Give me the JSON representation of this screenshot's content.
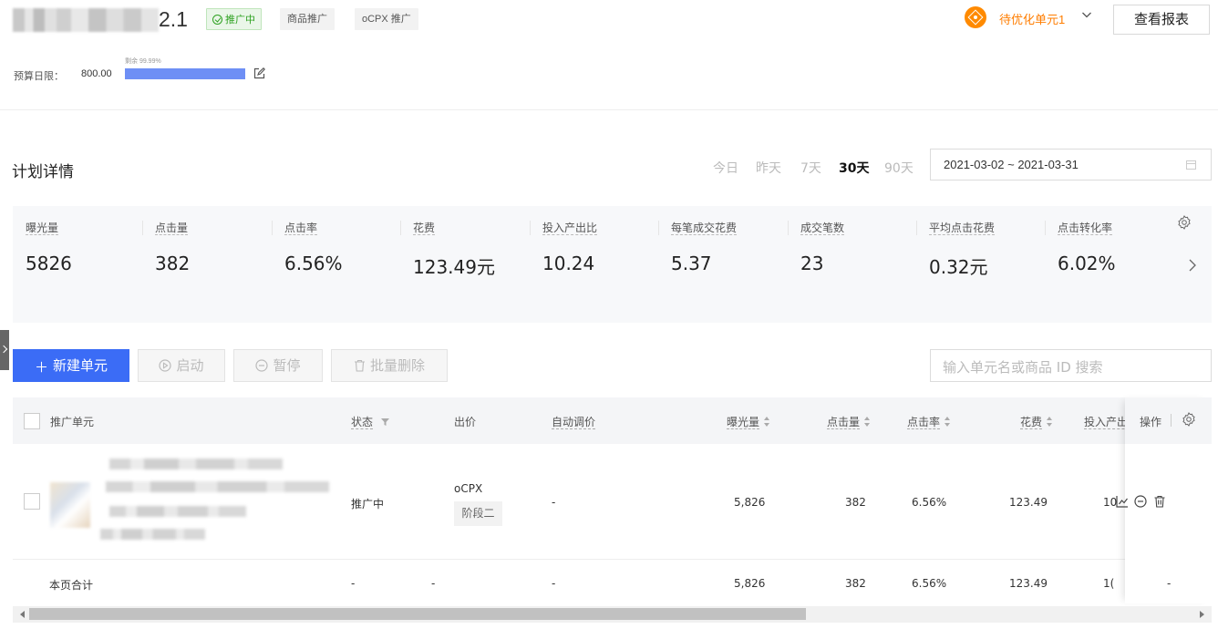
{
  "header": {
    "title_visible": "2.1",
    "status_tag": "推广中",
    "type_tags": [
      "商品推广",
      "oCPX 推广"
    ],
    "budget_label": "预算日限：",
    "budget_value": "800.00",
    "budget_remaining": "剩余 99.99%",
    "budget_remaining_fraction": 0.9999,
    "alert_text": "待优化单元1",
    "report_button": "查看报表"
  },
  "details": {
    "title": "计划详情",
    "ranges": [
      "今日",
      "昨天",
      "7天",
      "30天",
      "90天"
    ],
    "active_range": "30天",
    "date_range": "2021-03-02 ~ 2021-03-31"
  },
  "metrics": [
    {
      "label": "曝光量",
      "value": "5826"
    },
    {
      "label": "点击量",
      "value": "382"
    },
    {
      "label": "点击率",
      "value": "6.56%"
    },
    {
      "label": "花费",
      "value": "123.49元"
    },
    {
      "label": "投入产出比",
      "value": "10.24"
    },
    {
      "label": "每笔成交花费",
      "value": "5.37"
    },
    {
      "label": "成交笔数",
      "value": "23"
    },
    {
      "label": "平均点击花费",
      "value": "0.32元"
    },
    {
      "label": "点击转化率",
      "value": "6.02%"
    }
  ],
  "toolbar": {
    "new_unit": "新建单元",
    "start": "启动",
    "pause": "暂停",
    "batch_delete": "批量删除",
    "search_placeholder": "输入单元名或商品 ID 搜索"
  },
  "table": {
    "columns": {
      "unit": "推广单元",
      "status": "状态",
      "bid": "出价",
      "auto_bid": "自动调价",
      "impressions": "曝光量",
      "clicks": "点击量",
      "ctr": "点击率",
      "cost": "花费",
      "roi": "投入产出比",
      "actions": "操作"
    },
    "rows": [
      {
        "status": "推广中",
        "bid_type": "oCPX",
        "bid_stage": "阶段二",
        "auto_bid": "-",
        "impressions": "5,826",
        "clicks": "382",
        "ctr": "6.56%",
        "cost": "123.49",
        "roi": "10"
      }
    ],
    "summary": {
      "label": "本页合计",
      "status": "-",
      "bid": "-",
      "auto_bid": "-",
      "impressions": "5,826",
      "clicks": "382",
      "ctr": "6.56%",
      "cost": "123.49",
      "roi": "1(",
      "actions": "-"
    }
  },
  "colors": {
    "primary": "#3b6cf6",
    "alert": "#ff7d00",
    "status_green": "#2ea121",
    "budget_bar": "#6e8ff5"
  }
}
